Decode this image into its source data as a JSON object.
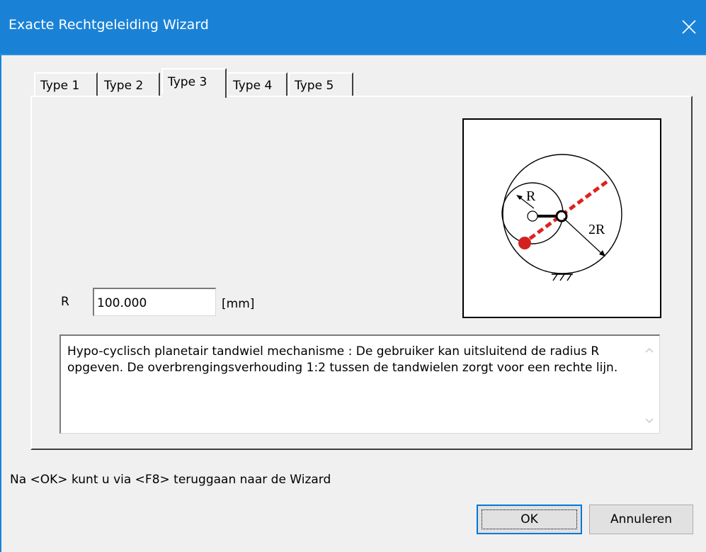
{
  "window": {
    "title": "Exacte Rechtgeleiding Wizard",
    "close_icon": "close-icon"
  },
  "tabs": [
    {
      "label": "Type 1",
      "selected": false
    },
    {
      "label": "Type 2",
      "selected": false
    },
    {
      "label": "Type 3",
      "selected": true
    },
    {
      "label": "Type 4",
      "selected": false
    },
    {
      "label": "Type 5",
      "selected": false
    }
  ],
  "diagram": {
    "label_r": "R",
    "label_2r": "2R",
    "line_color": "#e02020",
    "point_color": "#d42020"
  },
  "form": {
    "r_label": "R",
    "r_value": "100.000",
    "unit": "[mm]"
  },
  "description": "Hypo-cyclisch planetair tandwiel mechanisme : De gebruiker kan uitsluitend de radius R opgeven. De overbrengingsverhouding 1:2 tussen de tandwielen zorgt voor een rechte lijn.",
  "hint": "Na <OK> kunt u via <F8> teruggaan naar de Wizard",
  "buttons": {
    "ok": "OK",
    "cancel": "Annuleren"
  },
  "colors": {
    "titlebar": "#1a82d6",
    "background": "#f0f0f0"
  }
}
